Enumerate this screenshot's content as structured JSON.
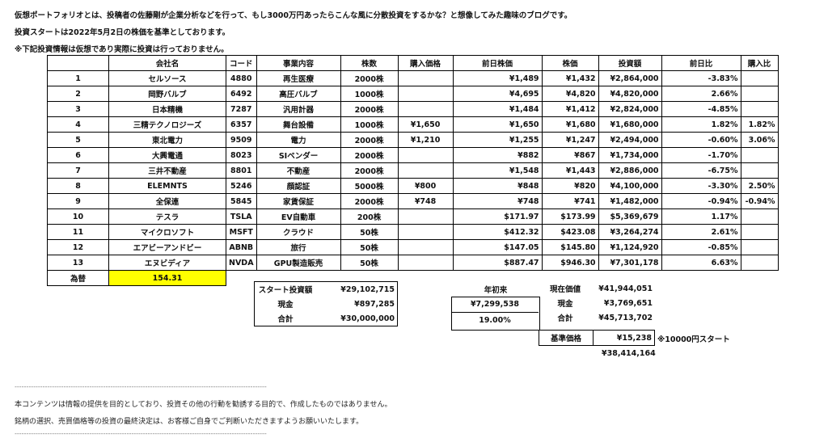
{
  "intro": {
    "line1": "仮想ポートフォリオとは、投稿者の佐藤剛が企業分析などを行って、もし3000万円あったらこんな風に分散投資をするかな？と想像してみた趣味のブログです。",
    "line2": "投資スタートは2022年5月2日の株価を基準としております。",
    "line3": "※下記投資情報は仮想であり実際に投資は行っておりません。"
  },
  "table": {
    "headers": [
      "",
      "会社名",
      "コード",
      "事業内容",
      "株数",
      "購入価格",
      "前日株価",
      "株価",
      "投資額",
      "前日比",
      "購入比"
    ],
    "rows": [
      [
        "1",
        "セルソース",
        "4880",
        "再生医療",
        "2000株",
        "",
        "¥1,489",
        "¥1,432",
        "¥2,864,000",
        "-3.83%",
        ""
      ],
      [
        "2",
        "岡野バルブ",
        "6492",
        "高圧バルブ",
        "1000株",
        "",
        "¥4,695",
        "¥4,820",
        "¥4,820,000",
        "2.66%",
        ""
      ],
      [
        "3",
        "日本精機",
        "7287",
        "汎用計器",
        "2000株",
        "",
        "¥1,484",
        "¥1,412",
        "¥2,824,000",
        "-4.85%",
        ""
      ],
      [
        "4",
        "三精テクノロジーズ",
        "6357",
        "舞台設備",
        "1000株",
        "¥1,650",
        "¥1,650",
        "¥1,680",
        "¥1,680,000",
        "1.82%",
        "1.82%"
      ],
      [
        "5",
        "東北電力",
        "9509",
        "電力",
        "2000株",
        "¥1,210",
        "¥1,255",
        "¥1,247",
        "¥2,494,000",
        "-0.60%",
        "3.06%"
      ],
      [
        "6",
        "大興電通",
        "8023",
        "SIベンダー",
        "2000株",
        "",
        "¥882",
        "¥867",
        "¥1,734,000",
        "-1.70%",
        ""
      ],
      [
        "7",
        "三井不動産",
        "8801",
        "不動産",
        "2000株",
        "",
        "¥1,548",
        "¥1,443",
        "¥2,886,000",
        "-6.75%",
        ""
      ],
      [
        "8",
        "ELEMNTS",
        "5246",
        "顔認証",
        "5000株",
        "¥800",
        "¥848",
        "¥820",
        "¥4,100,000",
        "-3.30%",
        "2.50%"
      ],
      [
        "9",
        "全保連",
        "5845",
        "家賃保証",
        "2000株",
        "¥748",
        "¥748",
        "¥741",
        "¥1,482,000",
        "-0.94%",
        "-0.94%"
      ],
      [
        "10",
        "テスラ",
        "TSLA",
        "EV自動車",
        "200株",
        "",
        "$171.97",
        "$173.99",
        "$5,369,679",
        "1.17%",
        ""
      ],
      [
        "11",
        "マイクロソフト",
        "MSFT",
        "クラウド",
        "50株",
        "",
        "$412.32",
        "$423.08",
        "¥3,264,274",
        "2.61%",
        ""
      ],
      [
        "12",
        "エアビーアンドビー",
        "ABNB",
        "旅行",
        "50株",
        "",
        "$147.05",
        "$145.80",
        "¥1,124,920",
        "-0.85%",
        ""
      ],
      [
        "13",
        "エヌビディア",
        "NVDA",
        "GPU製造販売",
        "50株",
        "",
        "$887.47",
        "$946.30",
        "¥7,301,178",
        "6.63%",
        ""
      ]
    ],
    "fx_label": "為替",
    "fx_value": "154.31"
  },
  "summary": {
    "start_label": "スタート投資額",
    "start_value": "¥29,102,715",
    "cash_label": "現金",
    "cash_value": "¥897,285",
    "total_label": "合計",
    "total_value": "¥30,000,000",
    "ytd_label": "年初来",
    "ytd_value": "¥7,299,538",
    "ytd_pct": "19.00%",
    "now_label": "現在価値",
    "now_value": "¥41,944,051",
    "now_cash_label": "現金",
    "now_cash_value": "¥3,769,651",
    "now_total_label": "合計",
    "now_total_value": "¥45,713,702",
    "base_label": "基準価格",
    "base_value": "¥15,238",
    "base_note": "※10000円スタート",
    "below_value": "¥38,414,164"
  },
  "footer": {
    "dashes": "------------------------------------------------------------------------------------------------------------",
    "disclaimer1": "本コンテンツは情報の提供を目的としており、投資その他の行動を勧誘する目的で、作成したものではありません。",
    "disclaimer2": "銘柄の選択、売買価格等の投資の最終決定は、お客様ご自身でご判断いただきますようお願いいたします。"
  }
}
